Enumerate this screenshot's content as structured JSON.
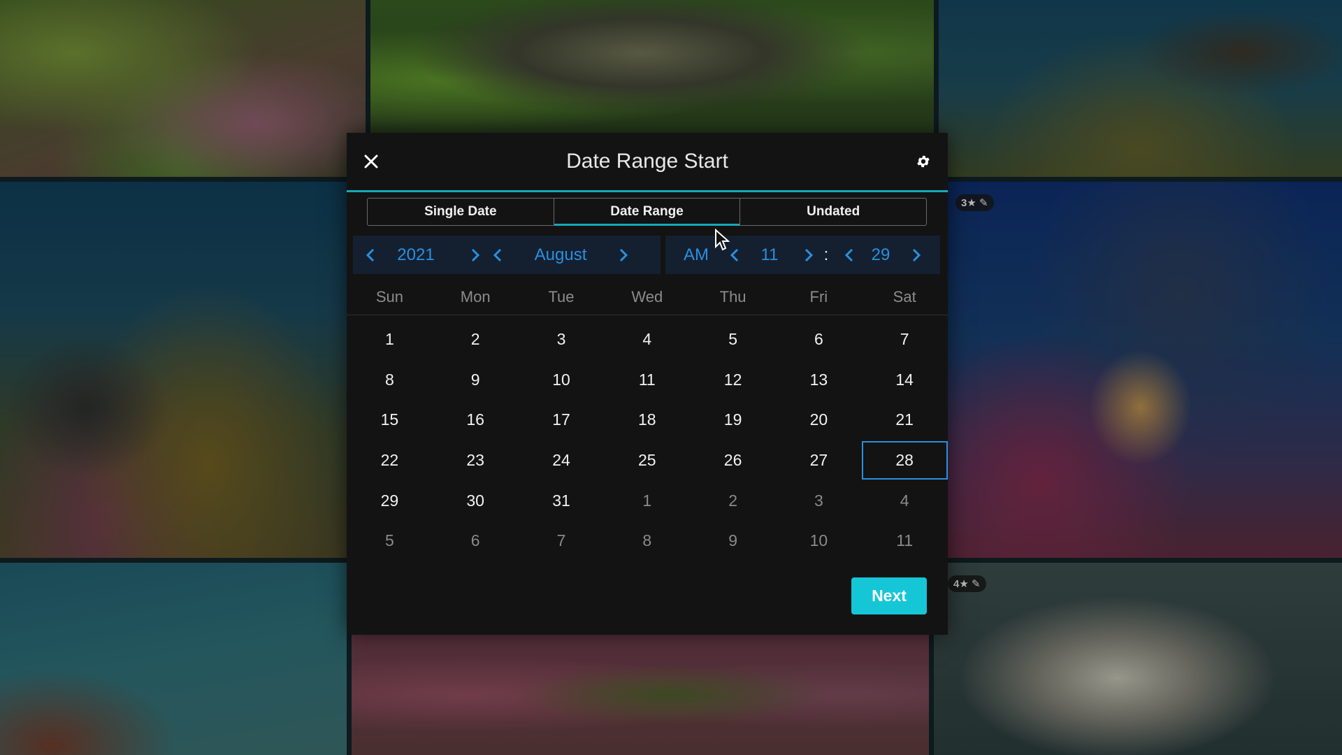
{
  "background": {
    "badges": [
      "3★",
      "4★"
    ]
  },
  "dialog": {
    "title": "Date Range Start",
    "close_icon": "close-icon",
    "settings_icon": "gear-icon",
    "tabs": [
      {
        "label": "Single Date",
        "active": false
      },
      {
        "label": "Date Range",
        "active": true
      },
      {
        "label": "Undated",
        "active": false
      }
    ],
    "pickers": {
      "year": "2021",
      "month": "August",
      "ampm": "AM",
      "hour": "11",
      "separator": ":",
      "minute": "29"
    },
    "weekdays": [
      "Sun",
      "Mon",
      "Tue",
      "Wed",
      "Thu",
      "Fri",
      "Sat"
    ],
    "weeks": [
      [
        "1",
        "2",
        "3",
        "4",
        "5",
        "6",
        "7"
      ],
      [
        "8",
        "9",
        "10",
        "11",
        "12",
        "13",
        "14"
      ],
      [
        "15",
        "16",
        "17",
        "18",
        "19",
        "20",
        "21"
      ],
      [
        "22",
        "23",
        "24",
        "25",
        "26",
        "27",
        "28"
      ],
      [
        "29",
        "30",
        "31",
        "1",
        "2",
        "3",
        "4"
      ],
      [
        "5",
        "6",
        "7",
        "8",
        "9",
        "10",
        "11"
      ]
    ],
    "selected_day": "28",
    "next_label": "Next",
    "colors": {
      "accent_teal": "#17a8b8",
      "picker_blue": "#2a8fe0",
      "next_button": "#15c6d6",
      "dialog_bg": "#131313"
    }
  }
}
